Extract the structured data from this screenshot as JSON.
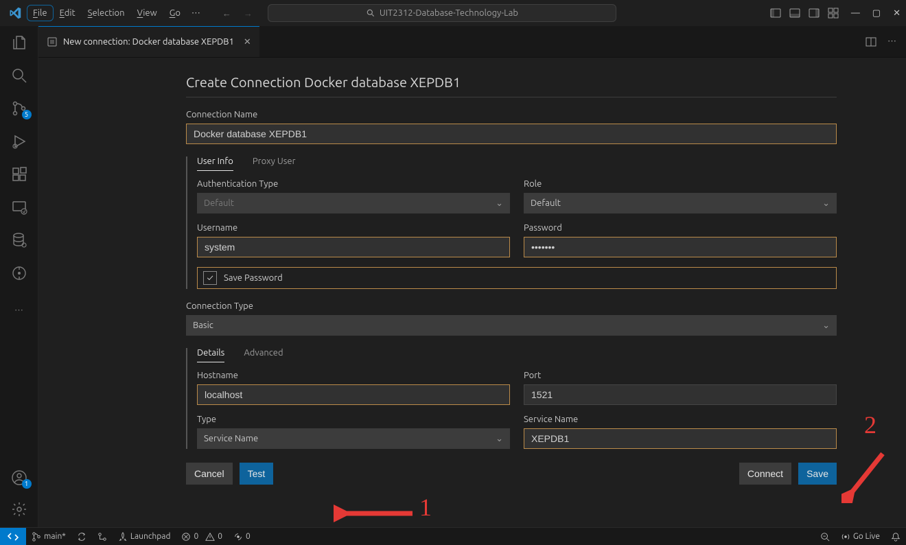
{
  "titlebar": {
    "menus": [
      "File",
      "Edit",
      "Selection",
      "View",
      "Go"
    ],
    "activeMenu": "File",
    "search_text": "UIT2312-Database-Technology-Lab"
  },
  "activitybar": {
    "scm_badge": "5",
    "account_badge": "1"
  },
  "tab": {
    "title": "New connection: Docker database XEPDB1"
  },
  "form": {
    "heading": "Create Connection Docker database XEPDB1",
    "conn_name_label": "Connection Name",
    "conn_name_value": "Docker database XEPDB1",
    "tabs": {
      "user_info": "User Info",
      "proxy_user": "Proxy User"
    },
    "auth_type_label": "Authentication Type",
    "auth_type_value": "Default",
    "role_label": "Role",
    "role_value": "Default",
    "username_label": "Username",
    "username_value": "system",
    "password_label": "Password",
    "password_value": "•••••••",
    "save_pw_label": "Save Password",
    "conn_type_label": "Connection Type",
    "conn_type_value": "Basic",
    "details_tabs": {
      "details": "Details",
      "advanced": "Advanced"
    },
    "hostname_label": "Hostname",
    "hostname_value": "localhost",
    "port_label": "Port",
    "port_value": "1521",
    "type_label": "Type",
    "type_value": "Service Name",
    "service_name_label": "Service Name",
    "service_name_value": "XEPDB1",
    "buttons": {
      "cancel": "Cancel",
      "test": "Test",
      "connect": "Connect",
      "save": "Save"
    }
  },
  "statusbar": {
    "branch": "main*",
    "launchpad": "Launchpad",
    "errors": "0",
    "warnings": "0",
    "ports": "0",
    "golive": "Go Live"
  },
  "annotations": {
    "one": "1",
    "two": "2"
  }
}
